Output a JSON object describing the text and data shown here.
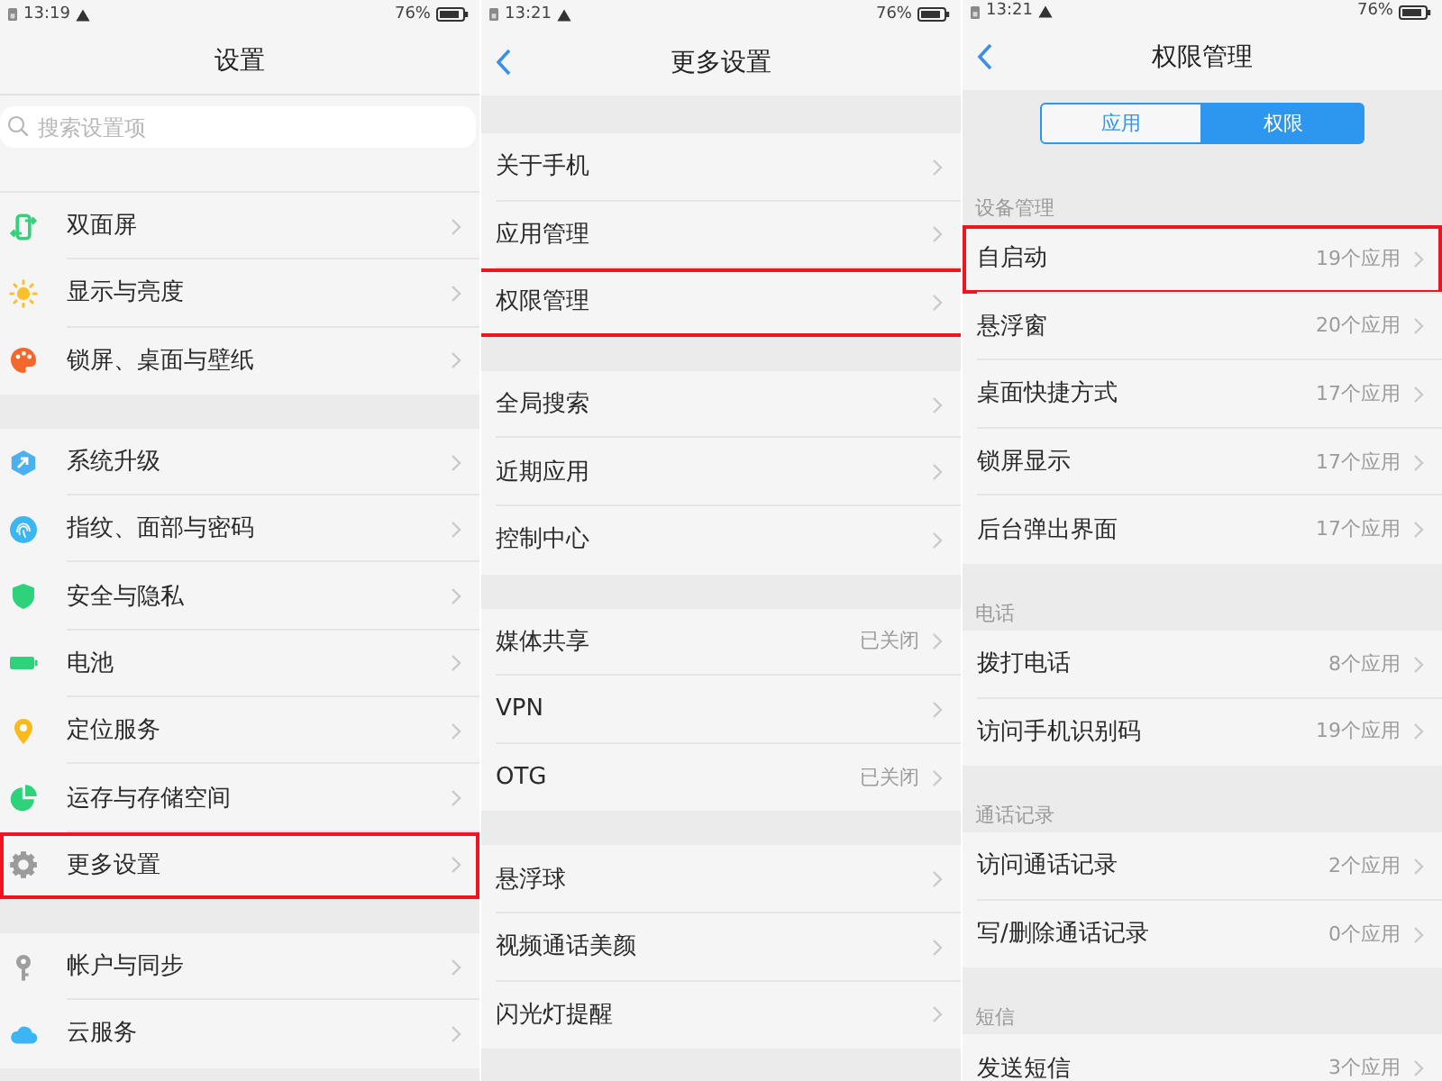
{
  "screens": [
    {
      "status_bar": {
        "time": "13:19",
        "battery": "76%"
      },
      "title": "设置",
      "back_button": false,
      "search": {
        "placeholder": "搜索设置项"
      },
      "groups": [
        {
          "items": [
            {
              "label": "双面屏",
              "color": "#34d07c",
              "highlighted": false
            },
            {
              "label": "显示与亮度",
              "color": "#fbc02d",
              "highlighted": false
            },
            {
              "label": "锁屏、桌面与壁纸",
              "color": "#f4682c",
              "highlighted": false
            }
          ]
        },
        {
          "items": [
            {
              "label": "系统升级",
              "color": "#4cb0ee",
              "highlighted": false
            },
            {
              "label": "指纹、面部与密码",
              "color": "#3cb6f2",
              "highlighted": false
            },
            {
              "label": "安全与隐私",
              "color": "#2ed27a",
              "highlighted": false
            },
            {
              "label": "电池",
              "color": "#2ed27a",
              "highlighted": false
            },
            {
              "label": "定位服务",
              "color": "#f9bb1c",
              "highlighted": false
            },
            {
              "label": "运存与存储空间",
              "color": "#2ed27a",
              "highlighted": false
            },
            {
              "label": "更多设置",
              "color": "#9b9b9b",
              "highlighted": true
            }
          ]
        },
        {
          "items": [
            {
              "label": "帐户与同步",
              "color": "#9e9e9e",
              "highlighted": false
            },
            {
              "label": "云服务",
              "color": "#3db5f5",
              "highlighted": false
            }
          ]
        }
      ]
    },
    {
      "status_bar": {
        "time": "13:21",
        "battery": "76%"
      },
      "title": "更多设置",
      "back_button": true,
      "groups": [
        {
          "items": [
            {
              "label": "关于手机",
              "highlighted": false
            },
            {
              "label": "应用管理",
              "highlighted": false
            },
            {
              "label": "权限管理",
              "highlighted": true
            }
          ]
        },
        {
          "items": [
            {
              "label": "全局搜索",
              "highlighted": false
            },
            {
              "label": "近期应用",
              "highlighted": false
            },
            {
              "label": "控制中心",
              "highlighted": false
            }
          ]
        },
        {
          "items": [
            {
              "label": "媒体共享",
              "value": "已关闭",
              "highlighted": false
            },
            {
              "label": "VPN",
              "highlighted": false
            },
            {
              "label": "OTG",
              "value": "已关闭",
              "highlighted": false
            }
          ]
        },
        {
          "items": [
            {
              "label": "悬浮球",
              "highlighted": false
            },
            {
              "label": "视频通话美颜",
              "highlighted": false
            },
            {
              "label": "闪光灯提醒",
              "highlighted": false
            }
          ]
        }
      ]
    },
    {
      "status_bar": {
        "time": "13:21",
        "battery": "76%"
      },
      "title": "权限管理",
      "back_button": true,
      "tabs": [
        {
          "label": "应用",
          "selected": false
        },
        {
          "label": "权限",
          "selected": true
        }
      ],
      "groups": [
        {
          "header": "设备管理",
          "items": [
            {
              "label": "自启动",
              "value": "19个应用",
              "highlighted": true
            },
            {
              "label": "悬浮窗",
              "value": "20个应用",
              "highlighted": false
            },
            {
              "label": "桌面快捷方式",
              "value": "17个应用",
              "highlighted": false
            },
            {
              "label": "锁屏显示",
              "value": "17个应用",
              "highlighted": false
            },
            {
              "label": "后台弹出界面",
              "value": "17个应用",
              "highlighted": false
            }
          ]
        },
        {
          "header": "电话",
          "items": [
            {
              "label": "拨打电话",
              "value": "8个应用",
              "highlighted": false
            },
            {
              "label": "访问手机识别码",
              "value": "19个应用",
              "highlighted": false
            }
          ]
        },
        {
          "header": "通话记录",
          "items": [
            {
              "label": "访问通话记录",
              "value": "2个应用",
              "highlighted": false
            },
            {
              "label": "写/删除通话记录",
              "value": "0个应用",
              "highlighted": false
            }
          ]
        },
        {
          "header": "短信",
          "items": [
            {
              "label": "发送短信",
              "value": "3个应用",
              "highlighted": false
            }
          ]
        }
      ]
    }
  ]
}
